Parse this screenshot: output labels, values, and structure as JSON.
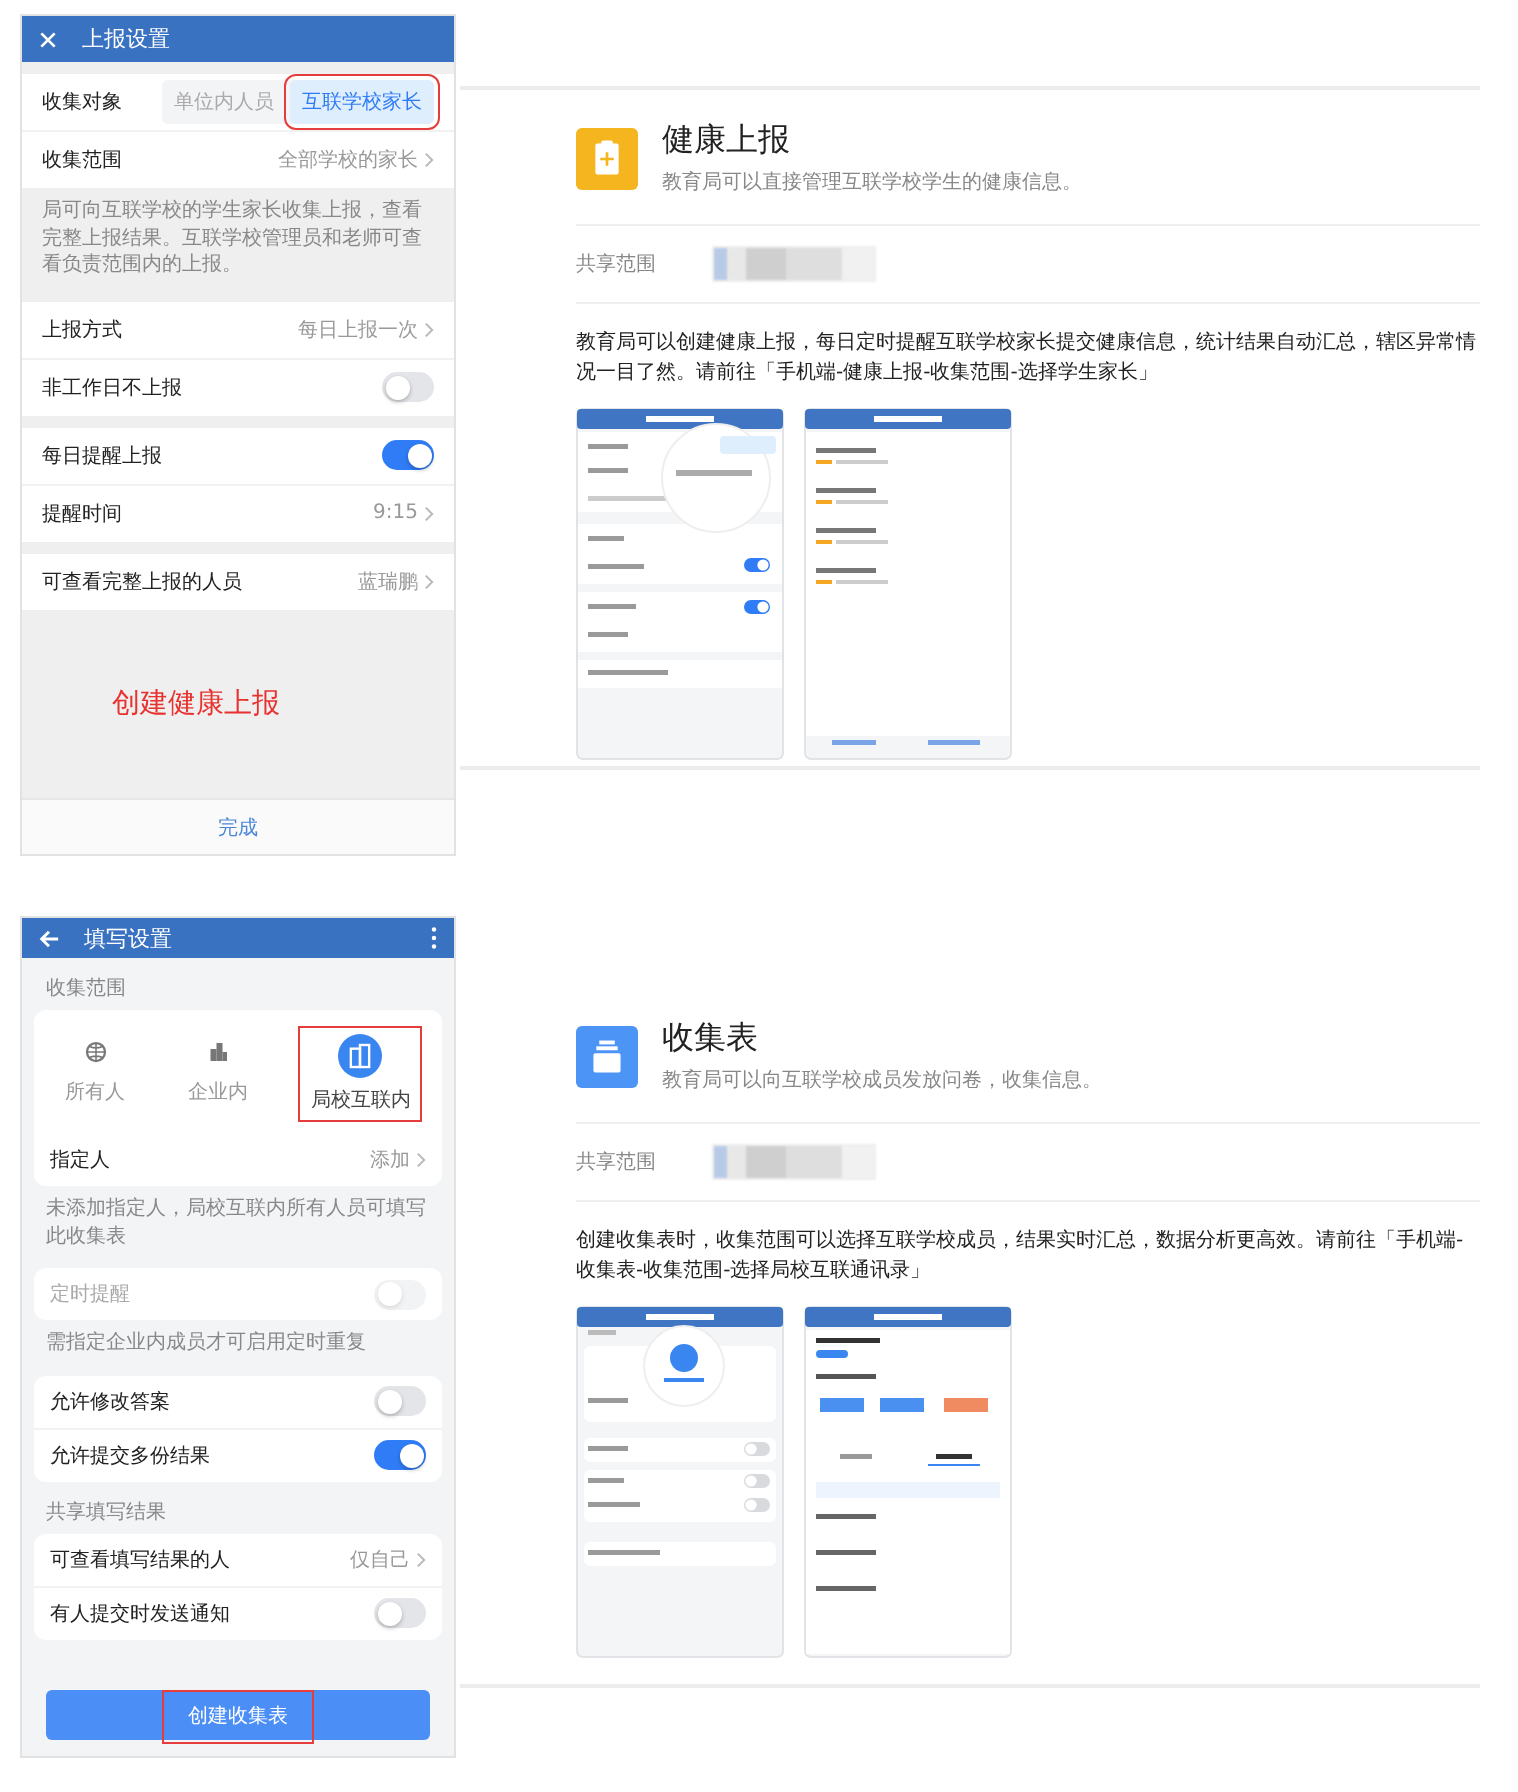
{
  "sections": [
    {
      "kind": "health",
      "phone": {
        "kind": "flat",
        "title": "上报设置",
        "groups": [
          {
            "rows": [
              {
                "kind": "segment",
                "label": "收集对象",
                "options": [
                  {
                    "label": "单位内人员",
                    "selected": false,
                    "highlighted": false
                  },
                  {
                    "label": "互联学校家长",
                    "selected": true,
                    "highlighted": true
                  }
                ]
              },
              {
                "kind": "nav",
                "label": "收集范围",
                "value": "全部学校的家长"
              }
            ],
            "note": "局可向互联学校的学生家长收集上报，查看完整上报结果。互联学校管理员和老师可查看负责范围内的上报。"
          },
          {
            "rows": [
              {
                "kind": "nav",
                "label": "上报方式",
                "value": "每日上报一次"
              },
              {
                "kind": "toggle",
                "label": "非工作日不上报",
                "on": false,
                "disabled": false
              }
            ]
          },
          {
            "rows": [
              {
                "kind": "toggle",
                "label": "每日提醒上报",
                "on": true,
                "disabled": false
              },
              {
                "kind": "nav",
                "label": "提醒时间",
                "value": "9:15"
              }
            ]
          },
          {
            "rows": [
              {
                "kind": "nav",
                "label": "可查看完整上报的人员",
                "value": "蓝瑞鹏"
              }
            ]
          }
        ],
        "annotation": "创建健康上报",
        "footer": {
          "kind": "plain",
          "label": "完成",
          "highlighted": false
        }
      },
      "info": {
        "color": "#f5b51f",
        "title": "健康上报",
        "subtitle": "教育局可以直接管理互联学校学生的健康信息。",
        "share_label": "共享范围",
        "description": "教育局可以创建健康上报，每日定时提醒互联学校家长提交健康信息，统计结果自动汇总，辖区异常情况一目了然。请前往「手机端-健康上报-收集范围-选择学生家长」"
      }
    },
    {
      "kind": "form",
      "phone": {
        "kind": "cards",
        "title": "填写设置",
        "groups": [
          {
            "label": "收集范围",
            "rows": [
              {
                "kind": "picker",
                "options": [
                  {
                    "label": "所有人",
                    "selected": false,
                    "highlighted": false
                  },
                  {
                    "label": "企业内",
                    "selected": false,
                    "highlighted": false
                  },
                  {
                    "label": "局校互联内",
                    "selected": true,
                    "highlighted": true
                  }
                ]
              },
              {
                "kind": "nav",
                "label": "指定人",
                "value": "添加"
              }
            ],
            "note": "未添加指定人，局校互联内所有人员可填写此收集表"
          },
          {
            "rows": [
              {
                "kind": "toggle",
                "label": "定时提醒",
                "on": false,
                "disabled": true
              }
            ],
            "note": "需指定企业内成员才可启用定时重复"
          },
          {
            "rows": [
              {
                "kind": "toggle",
                "label": "允许修改答案",
                "on": false,
                "disabled": false
              },
              {
                "kind": "toggle",
                "label": "允许提交多份结果",
                "on": true,
                "disabled": false
              }
            ]
          },
          {
            "label": "共享填写结果",
            "rows": [
              {
                "kind": "nav",
                "label": "可查看填写结果的人",
                "value": "仅自己"
              },
              {
                "kind": "toggle",
                "label": "有人提交时发送通知",
                "on": false,
                "disabled": false
              }
            ]
          }
        ],
        "footer": {
          "kind": "primary",
          "label": "创建收集表",
          "highlighted": true
        }
      },
      "info": {
        "color": "#4d94f7",
        "title": "收集表",
        "subtitle": "教育局可以向互联学校成员发放问卷，收集信息。",
        "share_label": "共享范围",
        "description": "创建收集表时，收集范围可以选择互联学校成员，结果实时汇总，数据分析更高效。请前往「手机端-收集表-收集范围-选择局校互联通讯录」"
      }
    }
  ]
}
